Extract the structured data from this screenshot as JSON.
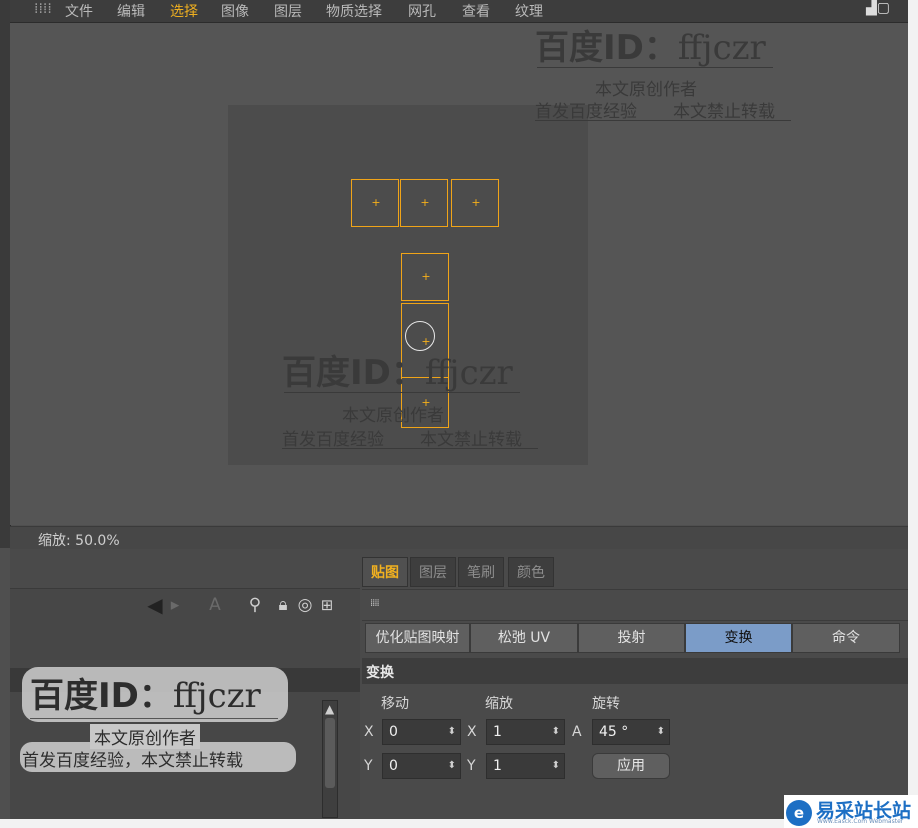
{
  "menu": {
    "items": [
      "文件",
      "编辑",
      "选择",
      "图像",
      "图层",
      "物质选择",
      "网孔",
      "查看",
      "纹理"
    ],
    "active_index": 2
  },
  "statusbar": {
    "zoom": "缩放: 50.0%"
  },
  "panel_tabs": [
    "贴图",
    "图层",
    "笔刷",
    "颜色"
  ],
  "panel_tabs_active": 0,
  "mode_buttons": [
    "优化贴图映射",
    "松弛 UV",
    "投射",
    "变换",
    "命令"
  ],
  "mode_buttons_active": 3,
  "transform": {
    "header": "变换",
    "move_label": "移动",
    "scale_label": "缩放",
    "rotate_label": "旋转",
    "move_x": "0",
    "move_y": "0",
    "scale_x": "1",
    "scale_y": "1",
    "rotate_a": "45 °",
    "axis_x": "X",
    "axis_y": "Y",
    "axis_a": "A",
    "apply": "应用"
  },
  "watermark": {
    "title": "百度ID：",
    "id": "ffjczr",
    "line1": "本文原创作者",
    "line2_a": "首发百度经验",
    "line2_b": "本文禁止转载",
    "line2_full": "首发百度经验，本文禁止转载"
  },
  "logo": {
    "text": "易采站长站",
    "sub": "Www.Easck.Com Webmaster"
  },
  "colors": {
    "uv_edge": "#f0a418",
    "active_tab": "#f0b020",
    "active_button": "#7b9cc8"
  }
}
